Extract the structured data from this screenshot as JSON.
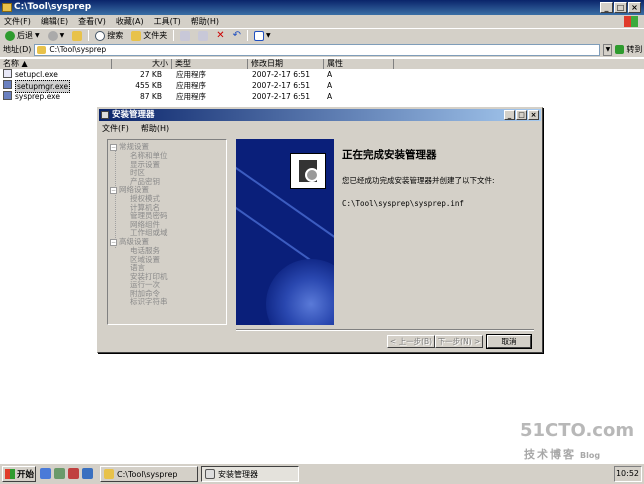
{
  "explorer": {
    "title": "C:\\Tool\\sysprep",
    "menu": [
      "文件(F)",
      "编辑(E)",
      "查看(V)",
      "收藏(A)",
      "工具(T)",
      "帮助(H)"
    ],
    "toolbar": {
      "back": "后退",
      "search": "搜索",
      "folders": "文件夹"
    },
    "address_label": "地址(D)",
    "address_value": "C:\\Tool\\sysprep",
    "go_label": "转到",
    "columns": [
      "名称 ▲",
      "大小",
      "类型",
      "修改日期",
      "属性"
    ],
    "files": [
      {
        "name": "setupcl.exe",
        "size": "27 KB",
        "type": "应用程序",
        "date": "2007-2-17 6:51",
        "attr": "A"
      },
      {
        "name": "setupmgr.exe",
        "size": "455 KB",
        "type": "应用程序",
        "date": "2007-2-17 6:51",
        "attr": "A"
      },
      {
        "name": "sysprep.exe",
        "size": "87 KB",
        "type": "应用程序",
        "date": "2007-2-17 6:51",
        "attr": "A"
      }
    ]
  },
  "dialog": {
    "title": "安装管理器",
    "menu": [
      "文件(F)",
      "帮助(H)"
    ],
    "tree": {
      "group1": "常规设置",
      "group1_items": [
        "名称和单位",
        "显示设置",
        "时区",
        "产品密钥"
      ],
      "group2": "网络设置",
      "group2_items": [
        "授权模式",
        "计算机名",
        "管理员密码",
        "网络组件",
        "工作组或域"
      ],
      "group3": "高级设置",
      "group3_items": [
        "电话服务",
        "区域设置",
        "语言",
        "安装打印机",
        "运行一次",
        "附加命令",
        "标识字符串"
      ]
    },
    "heading": "正在完成安装管理器",
    "description": "您已经成功完成安装管理器并创建了以下文件:",
    "file_path": "C:\\Tool\\sysprep\\sysprep.inf",
    "buttons": {
      "back": "< 上一步(B)",
      "next": "下一步(N) >",
      "cancel": "取消"
    }
  },
  "watermark": {
    "logo": "51CTO.com",
    "sub": "技术博客",
    "blog": "Blog"
  },
  "taskbar": {
    "start": "开始",
    "tasks": [
      "C:\\Tool\\sysprep",
      "安装管理器"
    ],
    "clock": "10:52"
  }
}
